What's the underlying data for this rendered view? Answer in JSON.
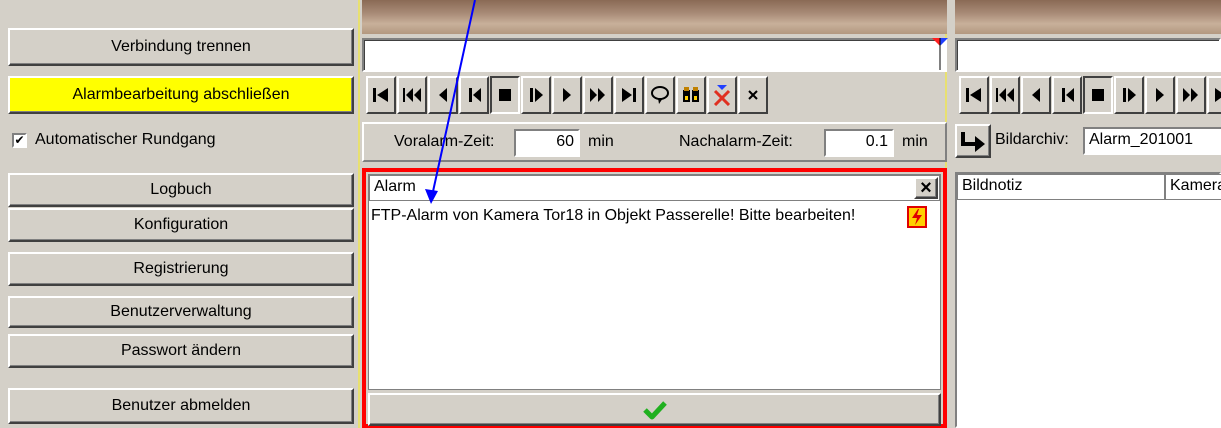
{
  "left_buttons": {
    "disconnect": "Verbindung trennen",
    "finish_alarm": "Alarmbearbeitung abschließen",
    "auto_tour_label": "Automatischer Rundgang",
    "auto_tour_checked": true,
    "logbook": "Logbuch",
    "configuration": "Konfiguration",
    "registration": "Registrierung",
    "user_management": "Benutzerverwaltung",
    "change_password": "Passwort ändern",
    "logout": "Benutzer abmelden"
  },
  "time_bar": {
    "pre_alarm_label": "Voralarm-Zeit:",
    "pre_alarm_value": "60",
    "pre_alarm_unit": "min",
    "post_alarm_label": "Nachalarm-Zeit:",
    "post_alarm_value": "0.1",
    "post_alarm_unit": "min"
  },
  "archive": {
    "label": "Bildarchiv:",
    "value": "Alarm_201001"
  },
  "alarm_panel": {
    "header": "Alarm",
    "close": "×",
    "message": "FTP-Alarm von Kamera Tor18 in Objekt Passerelle! Bitte bearbeiten!",
    "confirm_icon": "checkmark-icon"
  },
  "note_panel": {
    "col1": "Bildnotiz",
    "col2": "Kamera"
  },
  "toolbar_icons": [
    "skip-start-icon",
    "fast-rewind-icon",
    "play-back-icon",
    "step-back-icon",
    "stop-icon",
    "step-forward-icon",
    "play-icon",
    "fast-forward-icon",
    "skip-end-icon",
    "loop-icon",
    "binoculars-icon",
    "delete-marker-icon",
    "close-icon"
  ],
  "colors": {
    "alarm_border": "#ff0000",
    "highlight_button": "#ffff00",
    "annotation_arrow": "#0000ff"
  }
}
